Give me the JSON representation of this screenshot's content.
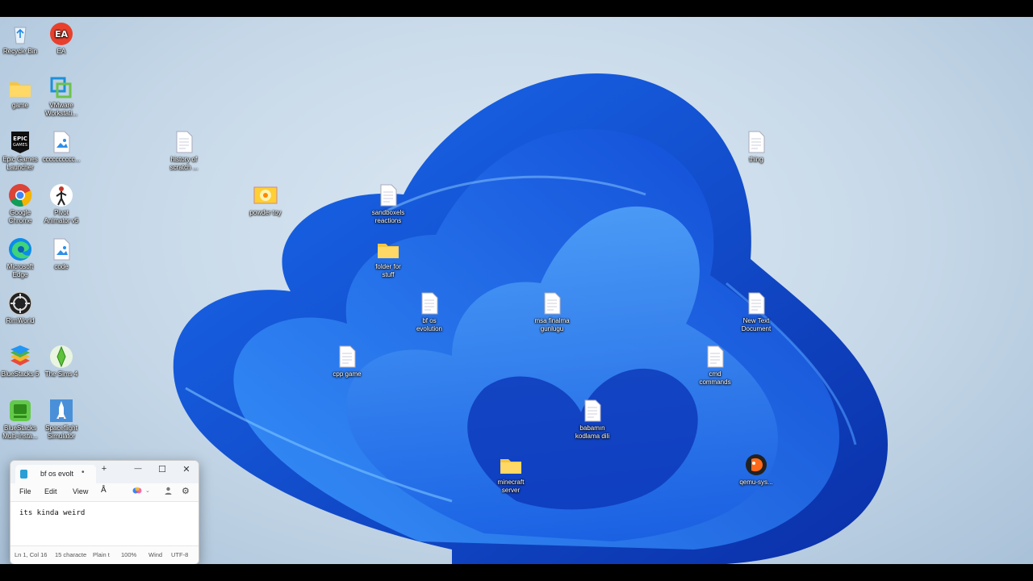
{
  "desktop": {
    "icons": [
      {
        "label": "Recycle Bin",
        "icon": "recycle-bin-icon"
      },
      {
        "label": "EA",
        "icon": "ea-icon"
      },
      {
        "label": "game",
        "icon": "folder-icon"
      },
      {
        "label": "VMware\nWorkstati...",
        "icon": "vmware-icon"
      },
      {
        "label": "Epic Games\nLauncher",
        "icon": "epic-games-icon"
      },
      {
        "label": "cccccccccc...",
        "icon": "image-file-icon"
      },
      {
        "label": "history of\nscratch ...",
        "icon": "text-file-icon"
      },
      {
        "label": "Google\nChrome",
        "icon": "chrome-icon"
      },
      {
        "label": "Pivot\nAnimator v5",
        "icon": "pivot-animator-icon"
      },
      {
        "label": "powder toy",
        "icon": "powder-toy-icon"
      },
      {
        "label": "sandboxels\nreactions",
        "icon": "text-file-icon"
      },
      {
        "label": "Microsoft\nEdge",
        "icon": "edge-icon"
      },
      {
        "label": "code",
        "icon": "image-file-icon"
      },
      {
        "label": "folder for\nstuff",
        "icon": "folder-icon"
      },
      {
        "label": "RimWorld",
        "icon": "rimworld-icon"
      },
      {
        "label": "bf os\nevolution",
        "icon": "text-file-icon"
      },
      {
        "label": "msa finalma\ngunlugu",
        "icon": "text-file-icon"
      },
      {
        "label": "thing",
        "icon": "text-file-icon"
      },
      {
        "label": "New Text\nDocument",
        "icon": "text-file-icon"
      },
      {
        "label": "BlueStacks 5",
        "icon": "bluestacks-icon"
      },
      {
        "label": "The Sims 4",
        "icon": "sims-icon"
      },
      {
        "label": "cpp game",
        "icon": "text-file-icon"
      },
      {
        "label": "cmd\ncommands",
        "icon": "text-file-icon"
      },
      {
        "label": "BlueStacks\nMulti-Insta...",
        "icon": "bluestacks-multi-icon"
      },
      {
        "label": "Spaceflight\nSimulator",
        "icon": "spaceflight-icon"
      },
      {
        "label": "babamın\nkodlama dili",
        "icon": "text-file-icon"
      },
      {
        "label": "minecraft\nserver",
        "icon": "folder-icon"
      },
      {
        "label": "qemu-sys...",
        "icon": "qemu-icon"
      }
    ]
  },
  "notepad": {
    "tab_title": "bf os evolt",
    "tab_modified": "•",
    "new_tab": "+",
    "minimize": "—",
    "maximize": "☐",
    "close": "✕",
    "menu": {
      "file": "File",
      "edit": "Edit",
      "view": "View"
    },
    "text": "its kinda weird",
    "status": {
      "position": "Ln 1, Col 16",
      "chars": "15 characte",
      "format": "Plain t",
      "zoom": "100%",
      "line_ending": "Wind",
      "encoding": "UTF-8"
    }
  }
}
